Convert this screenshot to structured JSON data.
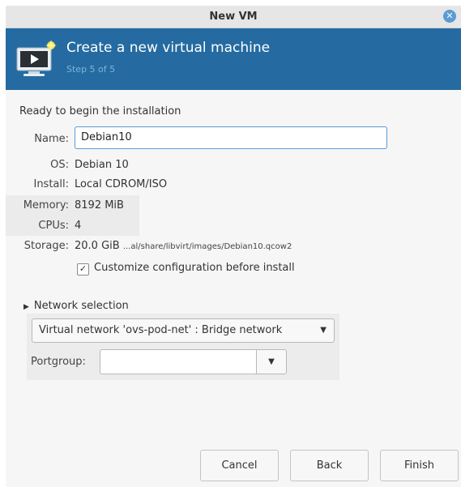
{
  "window": {
    "title": "New VM",
    "close_icon": "close-icon"
  },
  "banner": {
    "heading": "Create a new virtual machine",
    "step": "Step 5 of 5",
    "icon": "vm-create-icon",
    "colors": {
      "background": "#256ba1",
      "step_text": "#7fb4d9"
    }
  },
  "summary": {
    "ready_text": "Ready to begin the installation",
    "name": {
      "label": "Name:",
      "value": "Debian10"
    },
    "os": {
      "label": "OS:",
      "value": "Debian 10"
    },
    "install": {
      "label": "Install:",
      "value": "Local CDROM/ISO"
    },
    "memory": {
      "label": "Memory:",
      "value": "8192 MiB"
    },
    "cpus": {
      "label": "CPUs:",
      "value": "4"
    },
    "storage": {
      "label": "Storage:",
      "size": "20.0 GiB",
      "path": "...al/share/libvirt/images/Debian10.qcow2"
    },
    "customize": {
      "label": "Customize configuration before install",
      "checked": true
    }
  },
  "network": {
    "expander_label": "Network selection",
    "selected": "Virtual network 'ovs-pod-net' : Bridge network",
    "portgroup_label": "Portgroup:",
    "portgroup_value": ""
  },
  "buttons": {
    "cancel": "Cancel",
    "back": "Back",
    "finish": "Finish"
  }
}
